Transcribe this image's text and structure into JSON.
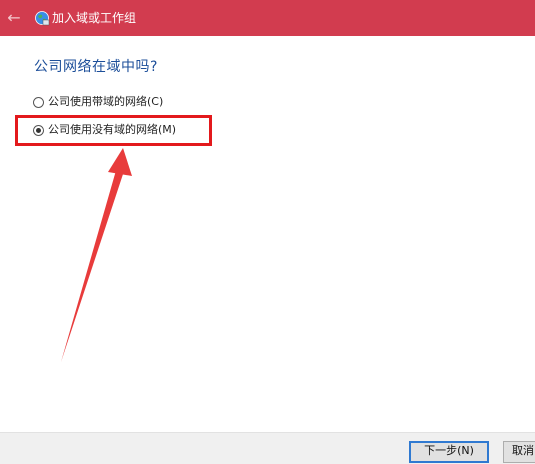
{
  "window": {
    "title": "加入域或工作组",
    "back_icon": "back-arrow-icon",
    "app_icon": "network-globe-icon",
    "colors": {
      "titlebar": "#d23c4f",
      "question": "#1d4f9a",
      "highlight": "#e3191c"
    }
  },
  "main": {
    "question": "公司网络在域中吗?",
    "options": [
      {
        "label": "公司使用带域的网络(C)",
        "selected": false
      },
      {
        "label": "公司使用没有域的网络(M)",
        "selected": true
      }
    ]
  },
  "footer": {
    "next_label": "下一步(N)",
    "cancel_label": "取消"
  }
}
